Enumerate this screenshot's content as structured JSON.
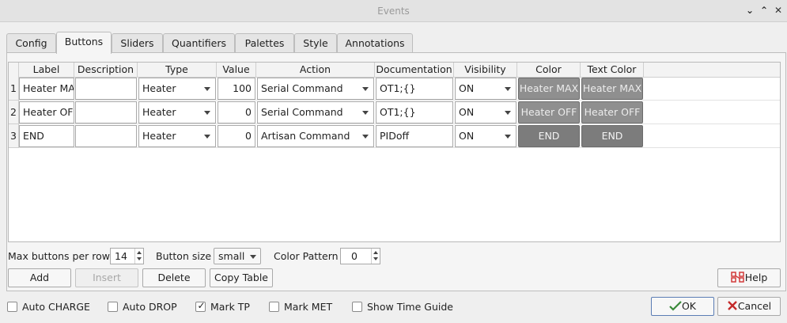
{
  "window": {
    "title": "Events"
  },
  "tabs": [
    {
      "label": "Config"
    },
    {
      "label": "Buttons"
    },
    {
      "label": "Sliders"
    },
    {
      "label": "Quantifiers"
    },
    {
      "label": "Palettes"
    },
    {
      "label": "Style"
    },
    {
      "label": "Annotations"
    }
  ],
  "active_tab": "Buttons",
  "table": {
    "columns": [
      "Label",
      "Description",
      "Type",
      "Value",
      "Action",
      "Documentation",
      "Visibility",
      "Color",
      "Text Color"
    ],
    "rows": [
      {
        "num": "1",
        "label": "Heater MAX",
        "description": "",
        "type": "Heater",
        "value": "100",
        "action": "Serial Command",
        "documentation": "OT1;{}",
        "visibility": "ON",
        "color": "Heater MAX",
        "text_color": "Heater MAX"
      },
      {
        "num": "2",
        "label": "Heater OFF",
        "description": "",
        "type": "Heater",
        "value": "0",
        "action": "Serial Command",
        "documentation": "OT1;{}",
        "visibility": "ON",
        "color": "Heater OFF",
        "text_color": "Heater OFF"
      },
      {
        "num": "3",
        "label": "END",
        "description": "",
        "type": "Heater",
        "value": "0",
        "action": "Artisan Command",
        "documentation": "PIDoff",
        "visibility": "ON",
        "color": "END",
        "text_color": "END"
      }
    ]
  },
  "controls": {
    "max_buttons_label": "Max buttons per row",
    "max_buttons_value": "14",
    "button_size_label": "Button size",
    "button_size_value": "small",
    "color_pattern_label": "Color Pattern",
    "color_pattern_value": "0"
  },
  "buttons": {
    "add": "Add",
    "insert": "Insert",
    "delete": "Delete",
    "copy_table": "Copy Table",
    "help": "Help",
    "ok": "OK",
    "cancel": "Cancel"
  },
  "checkboxes": [
    {
      "label": "Auto CHARGE",
      "checked": false
    },
    {
      "label": "Auto DROP",
      "checked": false
    },
    {
      "label": "Mark TP",
      "checked": true
    },
    {
      "label": "Mark MET",
      "checked": false
    },
    {
      "label": "Show Time Guide",
      "checked": false
    }
  ],
  "colors": {
    "button_fill": "#8f8f8f",
    "button_fill_dark": "#7c7c7c",
    "help_icon": "#d23a3a",
    "ok_icon": "#3a8a3a",
    "cancel_icon": "#c42b2b"
  }
}
